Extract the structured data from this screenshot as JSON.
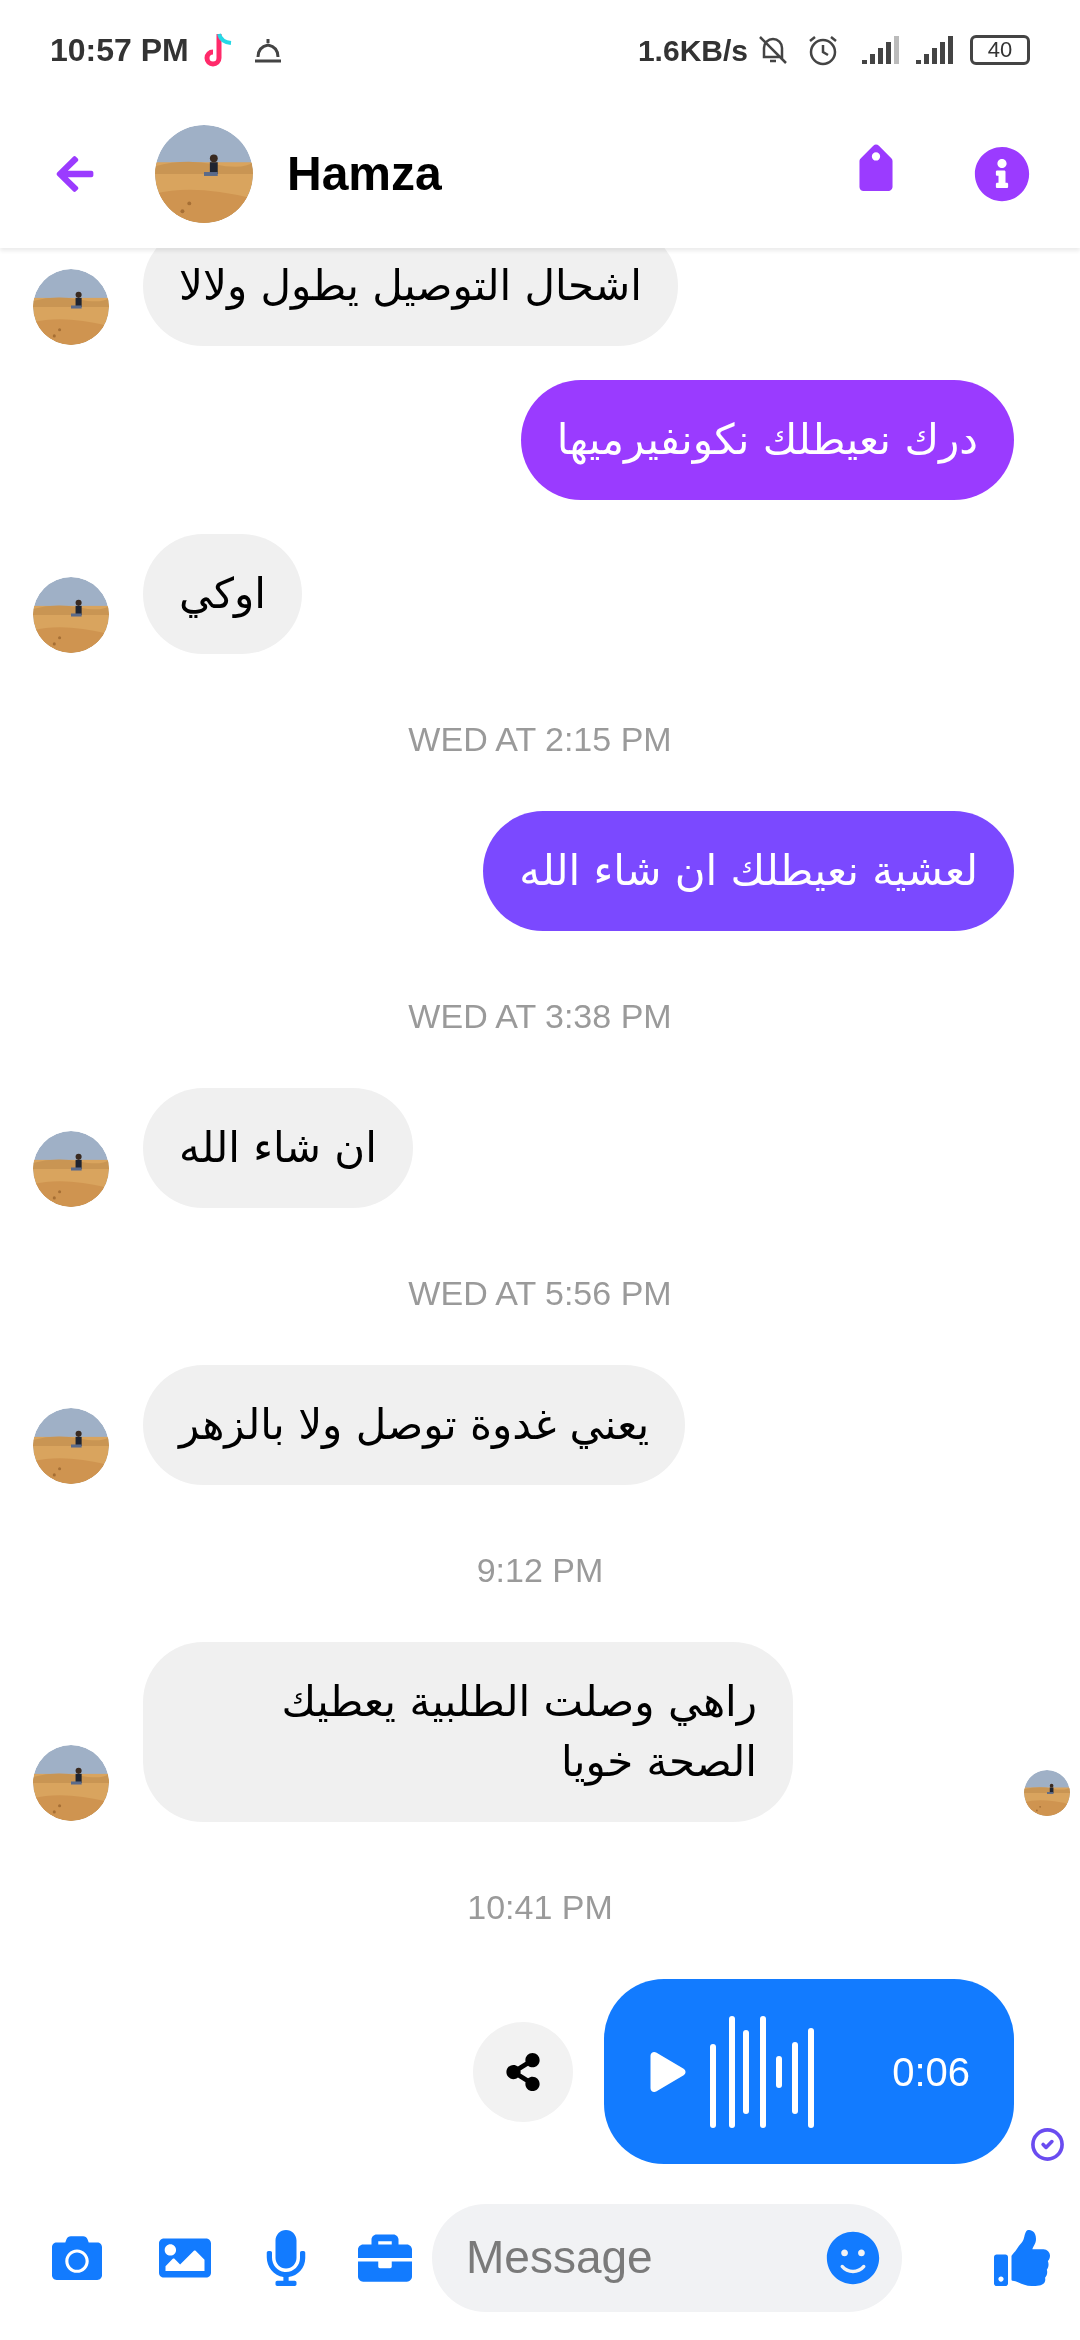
{
  "status_bar": {
    "time": "10:57 PM",
    "net_speed": "1.6KB/s",
    "battery": "40"
  },
  "header": {
    "name": "Hamza"
  },
  "messages": [
    {
      "kind": "received",
      "text": "اشحال التوصيل يطول ولالا",
      "avatar": true,
      "seen_avatar": false
    },
    {
      "kind": "sent",
      "text": "درك نعيطلك نكونفيرميها",
      "color": "#9a3bff"
    },
    {
      "kind": "received",
      "text": "اوكي",
      "avatar": true,
      "seen_avatar": false
    },
    {
      "kind": "timestamp",
      "text": "WED AT 2:15 PM"
    },
    {
      "kind": "sent",
      "text": "لعشية نعيطلك ان شاء الله",
      "color": "#7b49ff"
    },
    {
      "kind": "timestamp",
      "text": "WED AT 3:38 PM"
    },
    {
      "kind": "received",
      "text": "ان شاء الله",
      "avatar": true,
      "seen_avatar": false
    },
    {
      "kind": "timestamp",
      "text": "WED AT 5:56 PM"
    },
    {
      "kind": "received",
      "text": "يعني غدوة توصل ولا بالزهر",
      "avatar": true,
      "seen_avatar": false
    },
    {
      "kind": "timestamp",
      "text": "9:12 PM"
    },
    {
      "kind": "received",
      "text": "راهي وصلت الطلبية يعطيك الصحة خويا",
      "avatar": true,
      "seen_avatar": true
    },
    {
      "kind": "timestamp",
      "text": "10:41 PM"
    },
    {
      "kind": "audio",
      "duration": "0:06",
      "color": "#127bff",
      "delivered": true
    }
  ],
  "composer": {
    "placeholder": "Message"
  }
}
